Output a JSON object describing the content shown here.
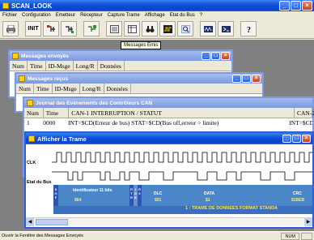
{
  "app": {
    "title": "SCAN_LOOK"
  },
  "menu": [
    "Fichier",
    "Configuration",
    "Emetteur",
    "Récepteur",
    "Capture Trame",
    "Affichage",
    "Etat du Bus",
    "?"
  ],
  "toolbar": {
    "init_label": "INIT",
    "tooltip": "Messages Emis"
  },
  "windows": {
    "sent": {
      "title": "Messages envoyés",
      "columns": [
        "Num",
        "Time",
        "ID-Msge",
        "Long/R",
        "Données"
      ]
    },
    "received": {
      "title": "Messages reçus",
      "columns": [
        "Num",
        "Time",
        "ID-Msge",
        "Long/R",
        "Données"
      ]
    },
    "journal": {
      "title": "Journal des Evénements des Contrôleurs CAN",
      "columns": [
        "Num",
        "Time",
        "CAN-1   INTERRUPTION   /   STATUT",
        "CAN-2"
      ],
      "rows": [
        {
          "num": "1",
          "time": "0000",
          "can1": "INT=$CD(Erreur de bus) STAT=$CD(Bus off,erreur > limite)",
          "can2": "INT=$CD"
        }
      ]
    },
    "trace": {
      "title": "Afficher la Trame",
      "clk_label": "CLK",
      "bus_label": "Etat du Bus",
      "fields": {
        "sof": "S O F",
        "identifier": "Identificateur 11 bits",
        "identifier_value": "$64",
        "rtr": "R T R",
        "ide": "I D E",
        "r0": "R 0",
        "dlc": "DLC",
        "dlc_value": "$01",
        "data": "DATA",
        "data_value": "$1",
        "crc": "CRC",
        "crc_value": "$1BEB"
      },
      "frame_label": "1 : TRAME DE DONNEES FORMAT STANDA"
    }
  },
  "status": {
    "text": "Ouvrir la Fenêtre des Messages Envoyés",
    "panel": "NUM"
  },
  "colors": {
    "field_blue": "#4b86c8",
    "field_dark": "#2a55b0",
    "titlebar": "#0a4fd6"
  }
}
